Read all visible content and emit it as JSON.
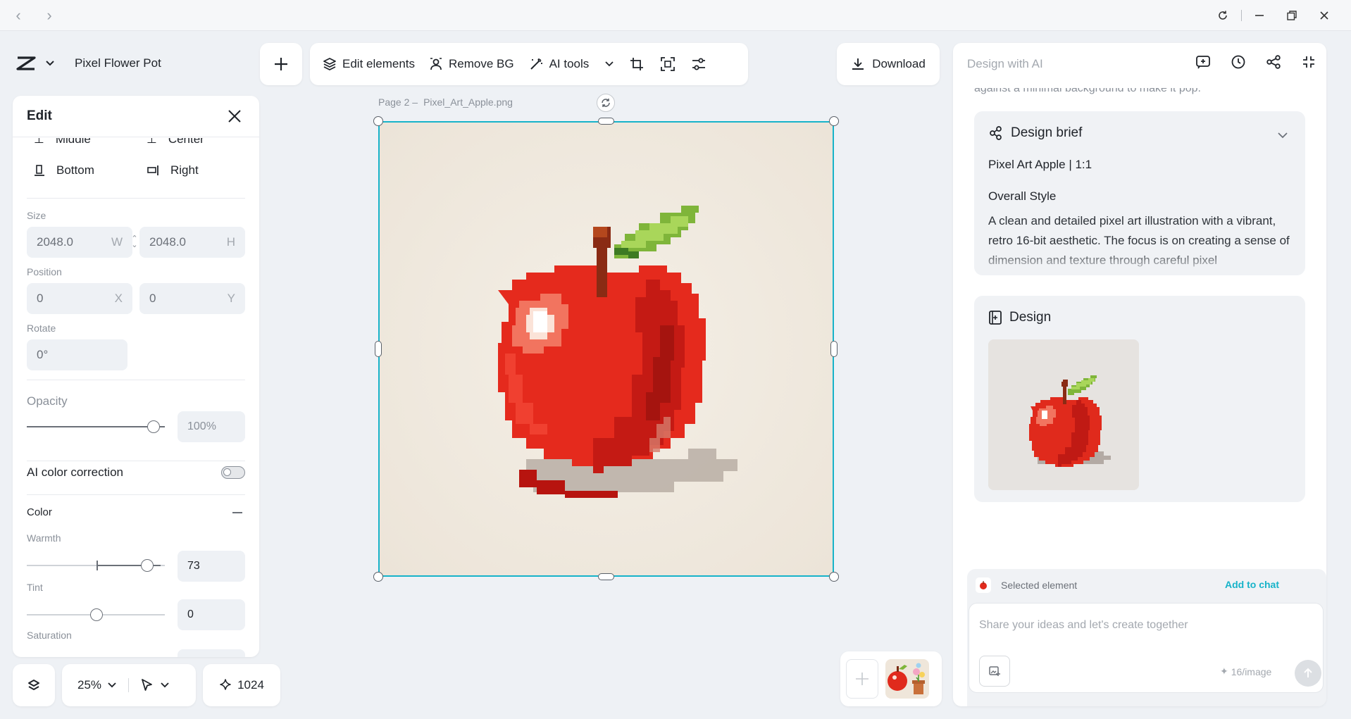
{
  "app": {
    "project_name": "Pixel Flower Pot",
    "page_label": "Page 2 –",
    "file_name": "Pixel_Art_Apple.png"
  },
  "toolbar": {
    "edit_elements": "Edit elements",
    "remove_bg": "Remove BG",
    "ai_tools": "AI tools",
    "download": "Download"
  },
  "edit_panel": {
    "title": "Edit",
    "align": {
      "middle": "Middle",
      "center": "Center",
      "bottom": "Bottom",
      "right": "Right"
    },
    "size_label": "Size",
    "width": "2048.0",
    "width_suffix": "W",
    "height": "2048.0",
    "height_suffix": "H",
    "position_label": "Position",
    "pos_x": "0",
    "pos_x_suffix": "X",
    "pos_y": "0",
    "pos_y_suffix": "Y",
    "rotate_label": "Rotate",
    "rotate": "0°",
    "opacity_label": "Opacity",
    "opacity": "100%",
    "opacity_level": 1.0,
    "ai_color_correction": "AI color correction",
    "ai_color_correction_on": false,
    "color_label": "Color",
    "warmth_label": "Warmth",
    "warmth": "73",
    "tint_label": "Tint",
    "tint": "0",
    "saturation_label": "Saturation"
  },
  "bottom_bar": {
    "zoom": "25%",
    "credits": "1024"
  },
  "ai_panel": {
    "title": "Design with AI",
    "intro_tail": "against a minimal background to make it pop.",
    "brief_title": "Design brief",
    "brief_name": "Pixel Art Apple | 1:1",
    "overall_style_label": "Overall Style",
    "overall_style_text": "A clean and detailed pixel art illustration with a vibrant, retro 16-bit aesthetic. The focus is on creating a sense of dimension and texture through careful pixel",
    "design_title": "Design",
    "selected_element": "Selected element",
    "add_to_chat": "Add to chat",
    "chat_placeholder": "Share your ideas and let's create together",
    "cost": "16/image"
  },
  "colors": {
    "accent": "#17b3c9",
    "apple_red": "#e02a1c",
    "leaf_green": "#7fb53a",
    "canvas_bg": "#f1ebe2"
  }
}
